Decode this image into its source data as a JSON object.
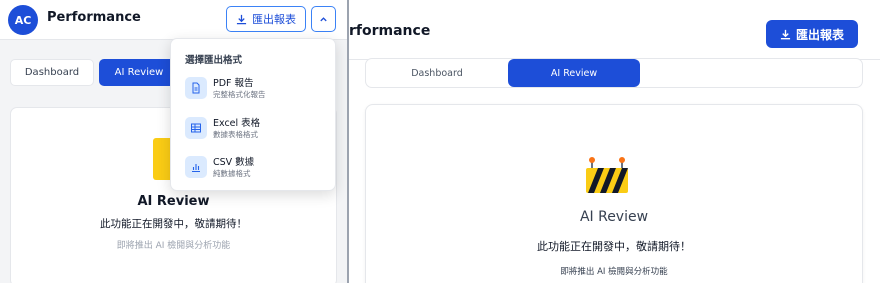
{
  "left": {
    "header": {
      "avatar_initials": "AC",
      "title": "Performance",
      "export_label": "匯出報表",
      "export_icon": "download-icon",
      "menu_toggle_icon": "chevron-up-icon"
    },
    "tabs": [
      {
        "label": "Dashboard",
        "active": false
      },
      {
        "label": "AI Review",
        "active": true
      }
    ],
    "card": {
      "icon": "construction-sign-icon",
      "title": "AI Review",
      "subtitle": "此功能正在開發中，敬請期待！",
      "note": "即將推出 AI 檢閱與分析功能"
    },
    "dropdown": {
      "heading": "選擇匯出格式",
      "items": [
        {
          "label": "PDF 報告",
          "description": "完整格式化報告",
          "icon": "document-icon"
        },
        {
          "label": "Excel 表格",
          "description": "數據表格格式",
          "icon": "table-icon"
        },
        {
          "label": "CSV 數據",
          "description": "純數據格式",
          "icon": "bar-chart-icon"
        }
      ]
    }
  },
  "right": {
    "header": {
      "title": "rformance",
      "export_label": "匯出報表",
      "export_icon": "download-icon"
    },
    "tabs": [
      {
        "label": "Dashboard",
        "active": false
      },
      {
        "label": "AI Review",
        "active": true
      }
    ],
    "card": {
      "icon": "construction-barrier-icon",
      "title": "AI Review",
      "subtitle": "此功能正在開發中，敬請期待！",
      "note": "即將推出 AI 檢閱與分析功能"
    }
  },
  "colors": {
    "accent": "#1d4ed8",
    "warning": "#facc15"
  }
}
